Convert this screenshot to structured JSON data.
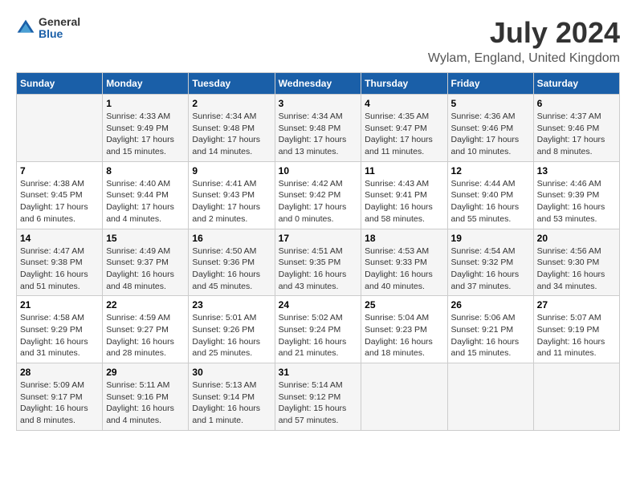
{
  "logo": {
    "general": "General",
    "blue": "Blue"
  },
  "title": "July 2024",
  "subtitle": "Wylam, England, United Kingdom",
  "days_header": [
    "Sunday",
    "Monday",
    "Tuesday",
    "Wednesday",
    "Thursday",
    "Friday",
    "Saturday"
  ],
  "weeks": [
    [
      {
        "day": "",
        "sunrise": "",
        "sunset": "",
        "daylight": ""
      },
      {
        "day": "1",
        "sunrise": "Sunrise: 4:33 AM",
        "sunset": "Sunset: 9:49 PM",
        "daylight": "Daylight: 17 hours and 15 minutes."
      },
      {
        "day": "2",
        "sunrise": "Sunrise: 4:34 AM",
        "sunset": "Sunset: 9:48 PM",
        "daylight": "Daylight: 17 hours and 14 minutes."
      },
      {
        "day": "3",
        "sunrise": "Sunrise: 4:34 AM",
        "sunset": "Sunset: 9:48 PM",
        "daylight": "Daylight: 17 hours and 13 minutes."
      },
      {
        "day": "4",
        "sunrise": "Sunrise: 4:35 AM",
        "sunset": "Sunset: 9:47 PM",
        "daylight": "Daylight: 17 hours and 11 minutes."
      },
      {
        "day": "5",
        "sunrise": "Sunrise: 4:36 AM",
        "sunset": "Sunset: 9:46 PM",
        "daylight": "Daylight: 17 hours and 10 minutes."
      },
      {
        "day": "6",
        "sunrise": "Sunrise: 4:37 AM",
        "sunset": "Sunset: 9:46 PM",
        "daylight": "Daylight: 17 hours and 8 minutes."
      }
    ],
    [
      {
        "day": "7",
        "sunrise": "Sunrise: 4:38 AM",
        "sunset": "Sunset: 9:45 PM",
        "daylight": "Daylight: 17 hours and 6 minutes."
      },
      {
        "day": "8",
        "sunrise": "Sunrise: 4:40 AM",
        "sunset": "Sunset: 9:44 PM",
        "daylight": "Daylight: 17 hours and 4 minutes."
      },
      {
        "day": "9",
        "sunrise": "Sunrise: 4:41 AM",
        "sunset": "Sunset: 9:43 PM",
        "daylight": "Daylight: 17 hours and 2 minutes."
      },
      {
        "day": "10",
        "sunrise": "Sunrise: 4:42 AM",
        "sunset": "Sunset: 9:42 PM",
        "daylight": "Daylight: 17 hours and 0 minutes."
      },
      {
        "day": "11",
        "sunrise": "Sunrise: 4:43 AM",
        "sunset": "Sunset: 9:41 PM",
        "daylight": "Daylight: 16 hours and 58 minutes."
      },
      {
        "day": "12",
        "sunrise": "Sunrise: 4:44 AM",
        "sunset": "Sunset: 9:40 PM",
        "daylight": "Daylight: 16 hours and 55 minutes."
      },
      {
        "day": "13",
        "sunrise": "Sunrise: 4:46 AM",
        "sunset": "Sunset: 9:39 PM",
        "daylight": "Daylight: 16 hours and 53 minutes."
      }
    ],
    [
      {
        "day": "14",
        "sunrise": "Sunrise: 4:47 AM",
        "sunset": "Sunset: 9:38 PM",
        "daylight": "Daylight: 16 hours and 51 minutes."
      },
      {
        "day": "15",
        "sunrise": "Sunrise: 4:49 AM",
        "sunset": "Sunset: 9:37 PM",
        "daylight": "Daylight: 16 hours and 48 minutes."
      },
      {
        "day": "16",
        "sunrise": "Sunrise: 4:50 AM",
        "sunset": "Sunset: 9:36 PM",
        "daylight": "Daylight: 16 hours and 45 minutes."
      },
      {
        "day": "17",
        "sunrise": "Sunrise: 4:51 AM",
        "sunset": "Sunset: 9:35 PM",
        "daylight": "Daylight: 16 hours and 43 minutes."
      },
      {
        "day": "18",
        "sunrise": "Sunrise: 4:53 AM",
        "sunset": "Sunset: 9:33 PM",
        "daylight": "Daylight: 16 hours and 40 minutes."
      },
      {
        "day": "19",
        "sunrise": "Sunrise: 4:54 AM",
        "sunset": "Sunset: 9:32 PM",
        "daylight": "Daylight: 16 hours and 37 minutes."
      },
      {
        "day": "20",
        "sunrise": "Sunrise: 4:56 AM",
        "sunset": "Sunset: 9:30 PM",
        "daylight": "Daylight: 16 hours and 34 minutes."
      }
    ],
    [
      {
        "day": "21",
        "sunrise": "Sunrise: 4:58 AM",
        "sunset": "Sunset: 9:29 PM",
        "daylight": "Daylight: 16 hours and 31 minutes."
      },
      {
        "day": "22",
        "sunrise": "Sunrise: 4:59 AM",
        "sunset": "Sunset: 9:27 PM",
        "daylight": "Daylight: 16 hours and 28 minutes."
      },
      {
        "day": "23",
        "sunrise": "Sunrise: 5:01 AM",
        "sunset": "Sunset: 9:26 PM",
        "daylight": "Daylight: 16 hours and 25 minutes."
      },
      {
        "day": "24",
        "sunrise": "Sunrise: 5:02 AM",
        "sunset": "Sunset: 9:24 PM",
        "daylight": "Daylight: 16 hours and 21 minutes."
      },
      {
        "day": "25",
        "sunrise": "Sunrise: 5:04 AM",
        "sunset": "Sunset: 9:23 PM",
        "daylight": "Daylight: 16 hours and 18 minutes."
      },
      {
        "day": "26",
        "sunrise": "Sunrise: 5:06 AM",
        "sunset": "Sunset: 9:21 PM",
        "daylight": "Daylight: 16 hours and 15 minutes."
      },
      {
        "day": "27",
        "sunrise": "Sunrise: 5:07 AM",
        "sunset": "Sunset: 9:19 PM",
        "daylight": "Daylight: 16 hours and 11 minutes."
      }
    ],
    [
      {
        "day": "28",
        "sunrise": "Sunrise: 5:09 AM",
        "sunset": "Sunset: 9:17 PM",
        "daylight": "Daylight: 16 hours and 8 minutes."
      },
      {
        "day": "29",
        "sunrise": "Sunrise: 5:11 AM",
        "sunset": "Sunset: 9:16 PM",
        "daylight": "Daylight: 16 hours and 4 minutes."
      },
      {
        "day": "30",
        "sunrise": "Sunrise: 5:13 AM",
        "sunset": "Sunset: 9:14 PM",
        "daylight": "Daylight: 16 hours and 1 minute."
      },
      {
        "day": "31",
        "sunrise": "Sunrise: 5:14 AM",
        "sunset": "Sunset: 9:12 PM",
        "daylight": "Daylight: 15 hours and 57 minutes."
      },
      {
        "day": "",
        "sunrise": "",
        "sunset": "",
        "daylight": ""
      },
      {
        "day": "",
        "sunrise": "",
        "sunset": "",
        "daylight": ""
      },
      {
        "day": "",
        "sunrise": "",
        "sunset": "",
        "daylight": ""
      }
    ]
  ]
}
